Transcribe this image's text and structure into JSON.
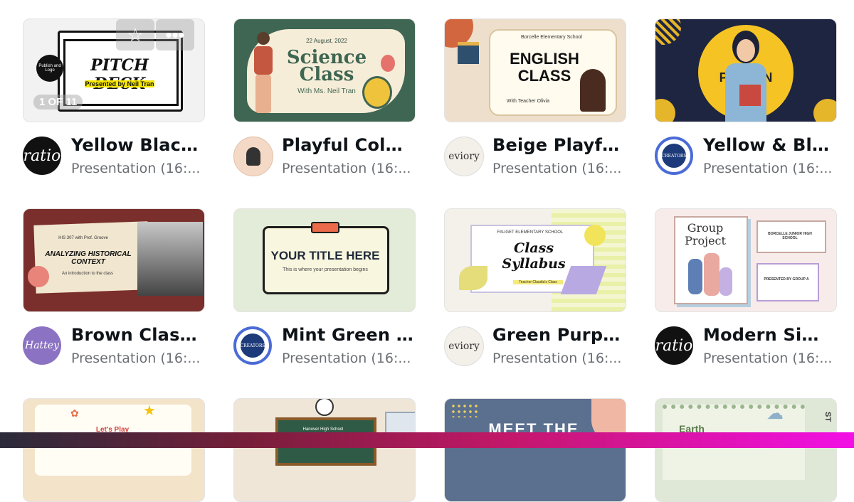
{
  "cards": [
    {
      "title": "Yellow Black ...",
      "subtitle": "Presentation (16:...",
      "avatar": "ratio",
      "thumb_heading": "PITCH DECK",
      "thumb_sub": "Presented by Neil Tran",
      "thumb_side": "Publish and Logo",
      "page_indicator": "1 OF 11"
    },
    {
      "title": "Playful Colorf...",
      "subtitle": "Presentation (16:...",
      "thumb_date": "22 August, 2022",
      "thumb_heading": "Science Class",
      "thumb_sub": "With Ms. Neil Tran"
    },
    {
      "title": "Beige Playful I...",
      "subtitle": "Presentation (16:...",
      "avatar": "eviory",
      "thumb_school": "Borcelle Elementary School",
      "thumb_heading": "ENGLISH CLASS",
      "thumb_sub": "With Teacher Olivia"
    },
    {
      "title": "Yellow & Black...",
      "subtitle": "Presentation (16:...",
      "avatar": "CREATORS",
      "thumb_heading": "P          N"
    },
    {
      "title": "Brown Classic ...",
      "subtitle": "Presentation (16:...",
      "avatar": "Hattey",
      "thumb_course": "HIS 307 with Prof. Groove",
      "thumb_heading": "ANALYZING HISTORICAL CONTEXT",
      "thumb_sub": "An introduction to the class"
    },
    {
      "title": "Mint Green Si...",
      "subtitle": "Presentation (16:...",
      "avatar": "CREATORS",
      "thumb_heading": "YOUR TITLE HERE",
      "thumb_sub": "This is where your presentation begins"
    },
    {
      "title": "Green Purple ...",
      "subtitle": "Presentation (16:...",
      "avatar": "eviory",
      "thumb_school": "FAUGET ELEMENTARY SCHOOL",
      "thumb_heading": "Class Syllabus",
      "thumb_sub": "Teacher Claudia's Class"
    },
    {
      "title": "Modern Simpl...",
      "subtitle": "Presentation (16:...",
      "avatar": "ratio",
      "thumb_heading": "Group Project",
      "thumb_school": "BORCELLE JUNIOR HIGH SCHOOL",
      "thumb_sub": "PRESENTED BY GROUP A"
    },
    {
      "thumb_heading": "Let's Play"
    },
    {
      "thumb_heading": "Hanover High School"
    },
    {
      "thumb_heading": "MEET THE"
    },
    {
      "thumb_heading": "Earth",
      "thumb_side": "ST"
    }
  ],
  "colors": {
    "bar_start": "#2a2b3a",
    "bar_end": "#f210e6",
    "title": "#0e1318",
    "subtitle": "#6b6f74"
  },
  "icons": {
    "favorite": "star-icon",
    "more": "more-icon"
  }
}
